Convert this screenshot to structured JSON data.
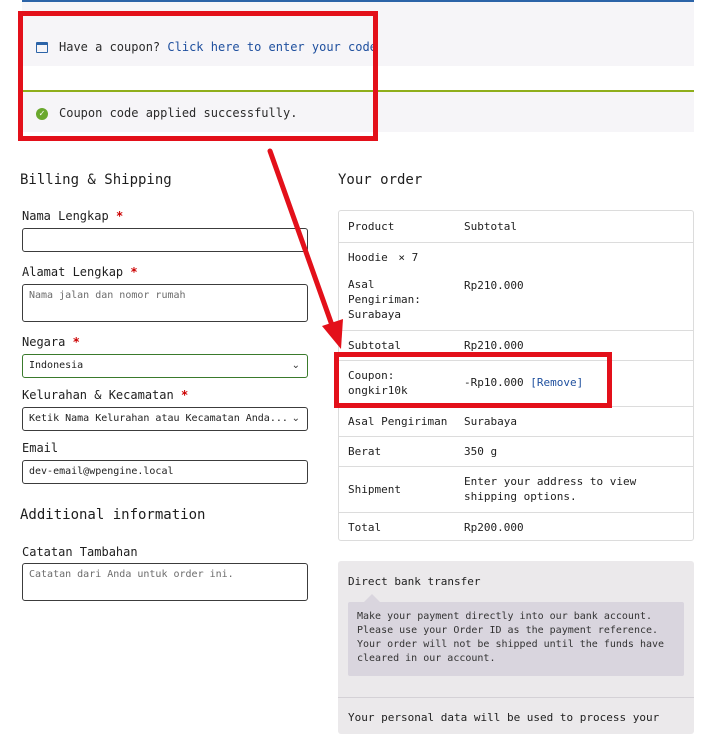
{
  "notices": {
    "coupon_prompt": "Have a coupon?",
    "coupon_link": "Click here to enter your code",
    "coupon_applied": "Coupon code applied successfully."
  },
  "billing": {
    "title": "Billing & Shipping",
    "fields": {
      "nama_label": "Nama Lengkap",
      "nama_value": "",
      "alamat_label": "Alamat Lengkap",
      "alamat_placeholder": "Nama jalan dan nomor rumah",
      "negara_label": "Negara",
      "negara_value": "Indonesia",
      "kelurahan_label": "Kelurahan & Kecamatan",
      "kelurahan_value": "Ketik Nama Kelurahan atau Kecamatan Anda...",
      "email_label": "Email",
      "email_value": "dev-email@wpengine.local"
    },
    "required_mark": "*"
  },
  "additional": {
    "title": "Additional information",
    "catatan_label": "Catatan Tambahan",
    "catatan_placeholder": "Catatan dari Anda untuk order ini."
  },
  "order": {
    "title": "Your order",
    "head_product": "Product",
    "head_subtotal": "Subtotal",
    "item_name": "Hoodie",
    "item_qty": "× 7",
    "item_meta_label": "Asal Pengiriman:",
    "item_meta_value": "Surabaya",
    "item_price": "Rp210.000",
    "subtotal_label": "Subtotal",
    "subtotal_value": "Rp210.000",
    "coupon_label": "Coupon:",
    "coupon_code": "ongkir10k",
    "coupon_value": "-Rp10.000",
    "coupon_remove": "[Remove]",
    "asal_label": "Asal Pengiriman",
    "asal_value": "Surabaya",
    "berat_label": "Berat",
    "berat_value": "350 g",
    "shipment_label": "Shipment",
    "shipment_value": "Enter your address to view shipping options.",
    "total_label": "Total",
    "total_value": "Rp200.000"
  },
  "payment": {
    "method": "Direct bank transfer",
    "description": "Make your payment directly into our bank account. Please use your Order ID as the payment reference. Your order will not be shipped until the funds have cleared in our account.",
    "privacy": "Your personal data will be used to process your"
  },
  "colors": {
    "annotation_red": "#e3101a",
    "info_blue": "#2c64a8",
    "success_green": "#8fae1b",
    "link": "#1e4f9e"
  }
}
